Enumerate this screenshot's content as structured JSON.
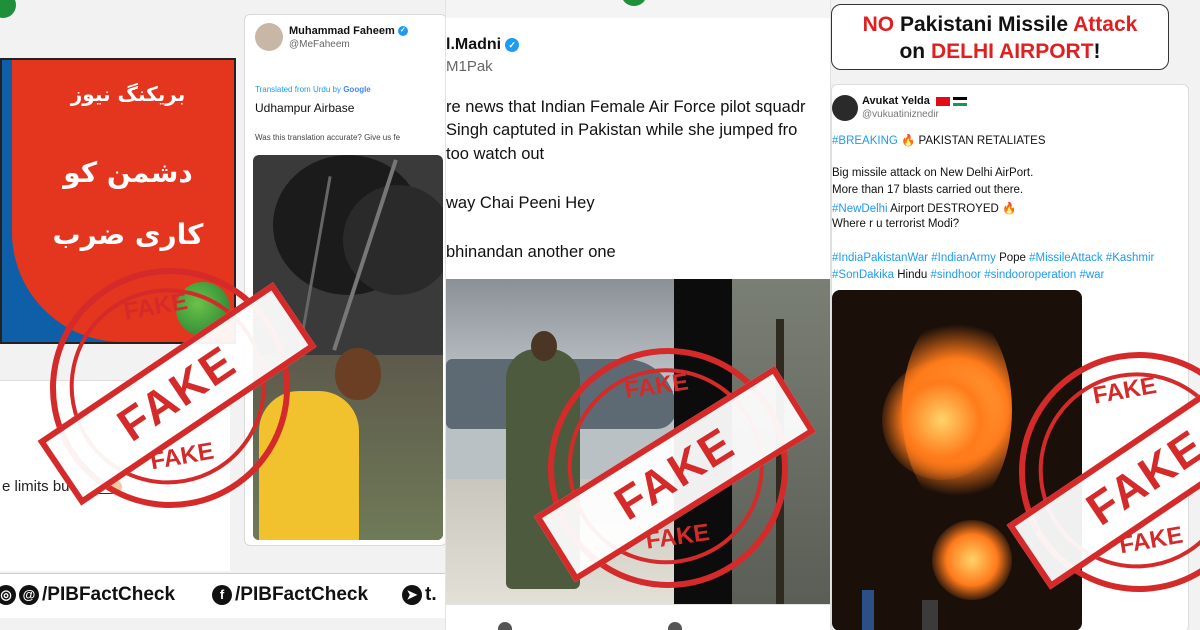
{
  "panel1": {
    "news_urdu_line1": "بریکنگ نیوز",
    "news_urdu_line2": "دشمن کو",
    "news_urdu_line3": "کاری ضرب",
    "left_text": "e limits but_____",
    "tweet": {
      "name": "Muhammad Faheem",
      "handle": "@MeFaheem",
      "translated": "Translated from Urdu by",
      "google": "Google",
      "body": "Udhampur Airbase",
      "accuracy": "Was this translation accurate? Give us fe"
    },
    "footer": {
      "item1": "/PIBFactCheck",
      "item2": "/PIBFactCheck",
      "item3": "t."
    }
  },
  "panel2": {
    "name": "l.Madni",
    "handle": "M1Pak",
    "lines": [
      "re news that Indian Female Air Force pilot squadr",
      "Singh captuted in Pakistan while she jumped fro",
      "too watch out",
      "way Chai Peeni Hey",
      "bhinandan another one"
    ]
  },
  "panel3": {
    "headline_no": "NO",
    "headline_pak": "Pakistani Missile",
    "headline_attack": "Attack",
    "headline_on": "on",
    "headline_delhi": "DELHI AIRPORT",
    "headline_bang": "!",
    "name": "Avukat Yelda",
    "handle": "@vukuatiniznedir",
    "breaking_tag": "#BREAKING",
    "breaking_text": "🔥 PAKISTAN RETALIATES",
    "line1": "Big missile attack on New Delhi AirPort.",
    "line2": "More than 17 blasts carried out there.",
    "newdelhi_tag": "#NewDelhi",
    "line3_rest": "Airport DESTROYED 🔥",
    "line4": "Where r u terrorist Modi?",
    "tags_line1_a": "#IndiaPakistanWar #IndianArmy",
    "tags_line1_b": "Pope",
    "tags_line1_c": "#MissileAttack #Kashmir",
    "tags_line2_a": "#SonDakika",
    "tags_line2_b": "Hindu",
    "tags_line2_c": "#sindhoor #sindooroperation #war"
  },
  "stamp": {
    "top_word": "FAKE",
    "band_word": "FAKE",
    "bottom_word": "FAKE"
  },
  "colors": {
    "stamp_red": "#d42a2a",
    "link_blue": "#1d9bf0",
    "headline_red": "#e02020"
  }
}
